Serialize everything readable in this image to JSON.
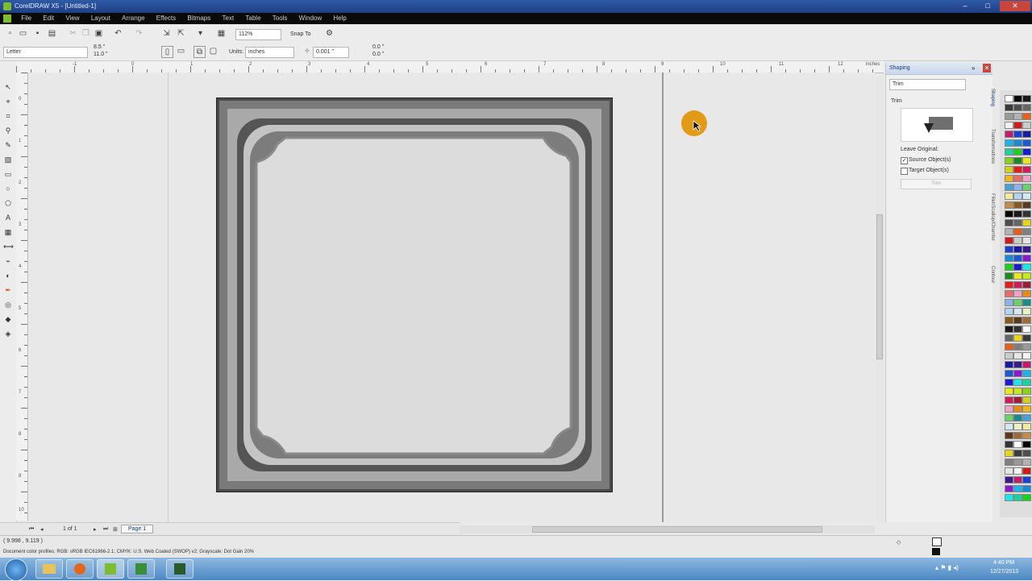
{
  "window": {
    "title": "CorelDRAW X5 - [Untitled-1]",
    "min": "–",
    "max": "□",
    "close": "✕"
  },
  "menu": {
    "items": [
      "File",
      "Edit",
      "View",
      "Layout",
      "Arrange",
      "Effects",
      "Bitmaps",
      "Text",
      "Table",
      "Tools",
      "Window",
      "Help"
    ]
  },
  "standard_toolbar": {
    "zoom": "112%",
    "snap": "Snap To"
  },
  "property_bar": {
    "page_size": "Letter",
    "width": "8.5 \"",
    "height": "11.0 \"",
    "units_label": "Units:",
    "units": "inches",
    "nudge": "0.001 \"",
    "dup_x": "0.0 \"",
    "dup_y": "0.0 \""
  },
  "ruler": {
    "units": "inches",
    "h_labels": [
      "-1",
      "0",
      "1",
      "2",
      "3",
      "4",
      "5",
      "6",
      "7",
      "8",
      "9",
      "10",
      "11",
      "12"
    ],
    "v_labels": [
      "0",
      "1",
      "2",
      "3",
      "4",
      "5",
      "6",
      "7",
      "8",
      "9",
      "10"
    ]
  },
  "page_nav": {
    "counter": "1 of 1",
    "tab": "Page 1"
  },
  "status": {
    "coords": "( 9.998 , 9.119 )",
    "profiles": "Document color profiles: RGB: sRGB IEC61966-2.1; CMYK: U.S. Web Coated (SWOP) v2; Grayscale: Dot Gain 20%"
  },
  "docker": {
    "title": "Shaping",
    "mode": "Trim",
    "section": "Trim",
    "leave_original": "Leave Original:",
    "source_label": "Source Object(s)",
    "target_label": "Target Object(s)",
    "source_checked": true,
    "target_checked": false,
    "apply": "Trim",
    "tabs": [
      "Shaping",
      "Transformations",
      "Fillet/Scallop/Chamfer",
      "Contour"
    ]
  },
  "taskbar": {
    "time": "4:40 PM",
    "date": "12/27/2013"
  },
  "colors": {
    "accent": "#2f5aa6",
    "cursor_halo": "#e39a16",
    "frame_dark": "#2a2a2a"
  }
}
